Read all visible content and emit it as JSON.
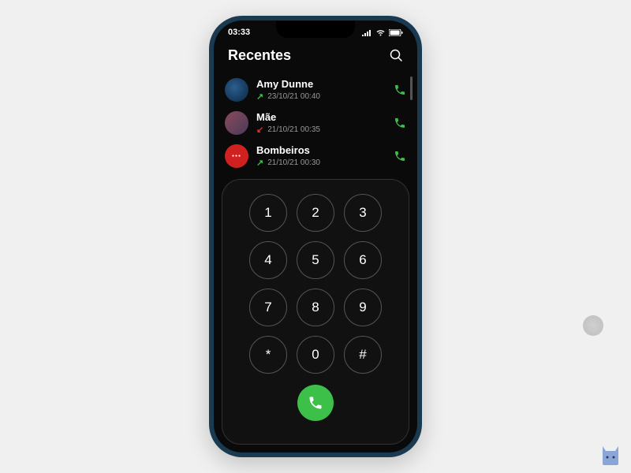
{
  "status": {
    "time": "03:33"
  },
  "header": {
    "title": "Recentes"
  },
  "calls": [
    {
      "name": "Amy Dunne",
      "time": "23/10/21  00:40",
      "direction": "outgoing"
    },
    {
      "name": "Mãe",
      "time": "21/10/21  00:35",
      "direction": "missed"
    },
    {
      "name": "Bombeiros",
      "time": "21/10/21  00:30",
      "direction": "outgoing"
    }
  ],
  "dialpad": {
    "keys": [
      "1",
      "2",
      "3",
      "4",
      "5",
      "6",
      "7",
      "8",
      "9",
      "*",
      "0",
      "#"
    ]
  },
  "colors": {
    "accent_green": "#3cc04a",
    "missed_red": "#e03030"
  }
}
